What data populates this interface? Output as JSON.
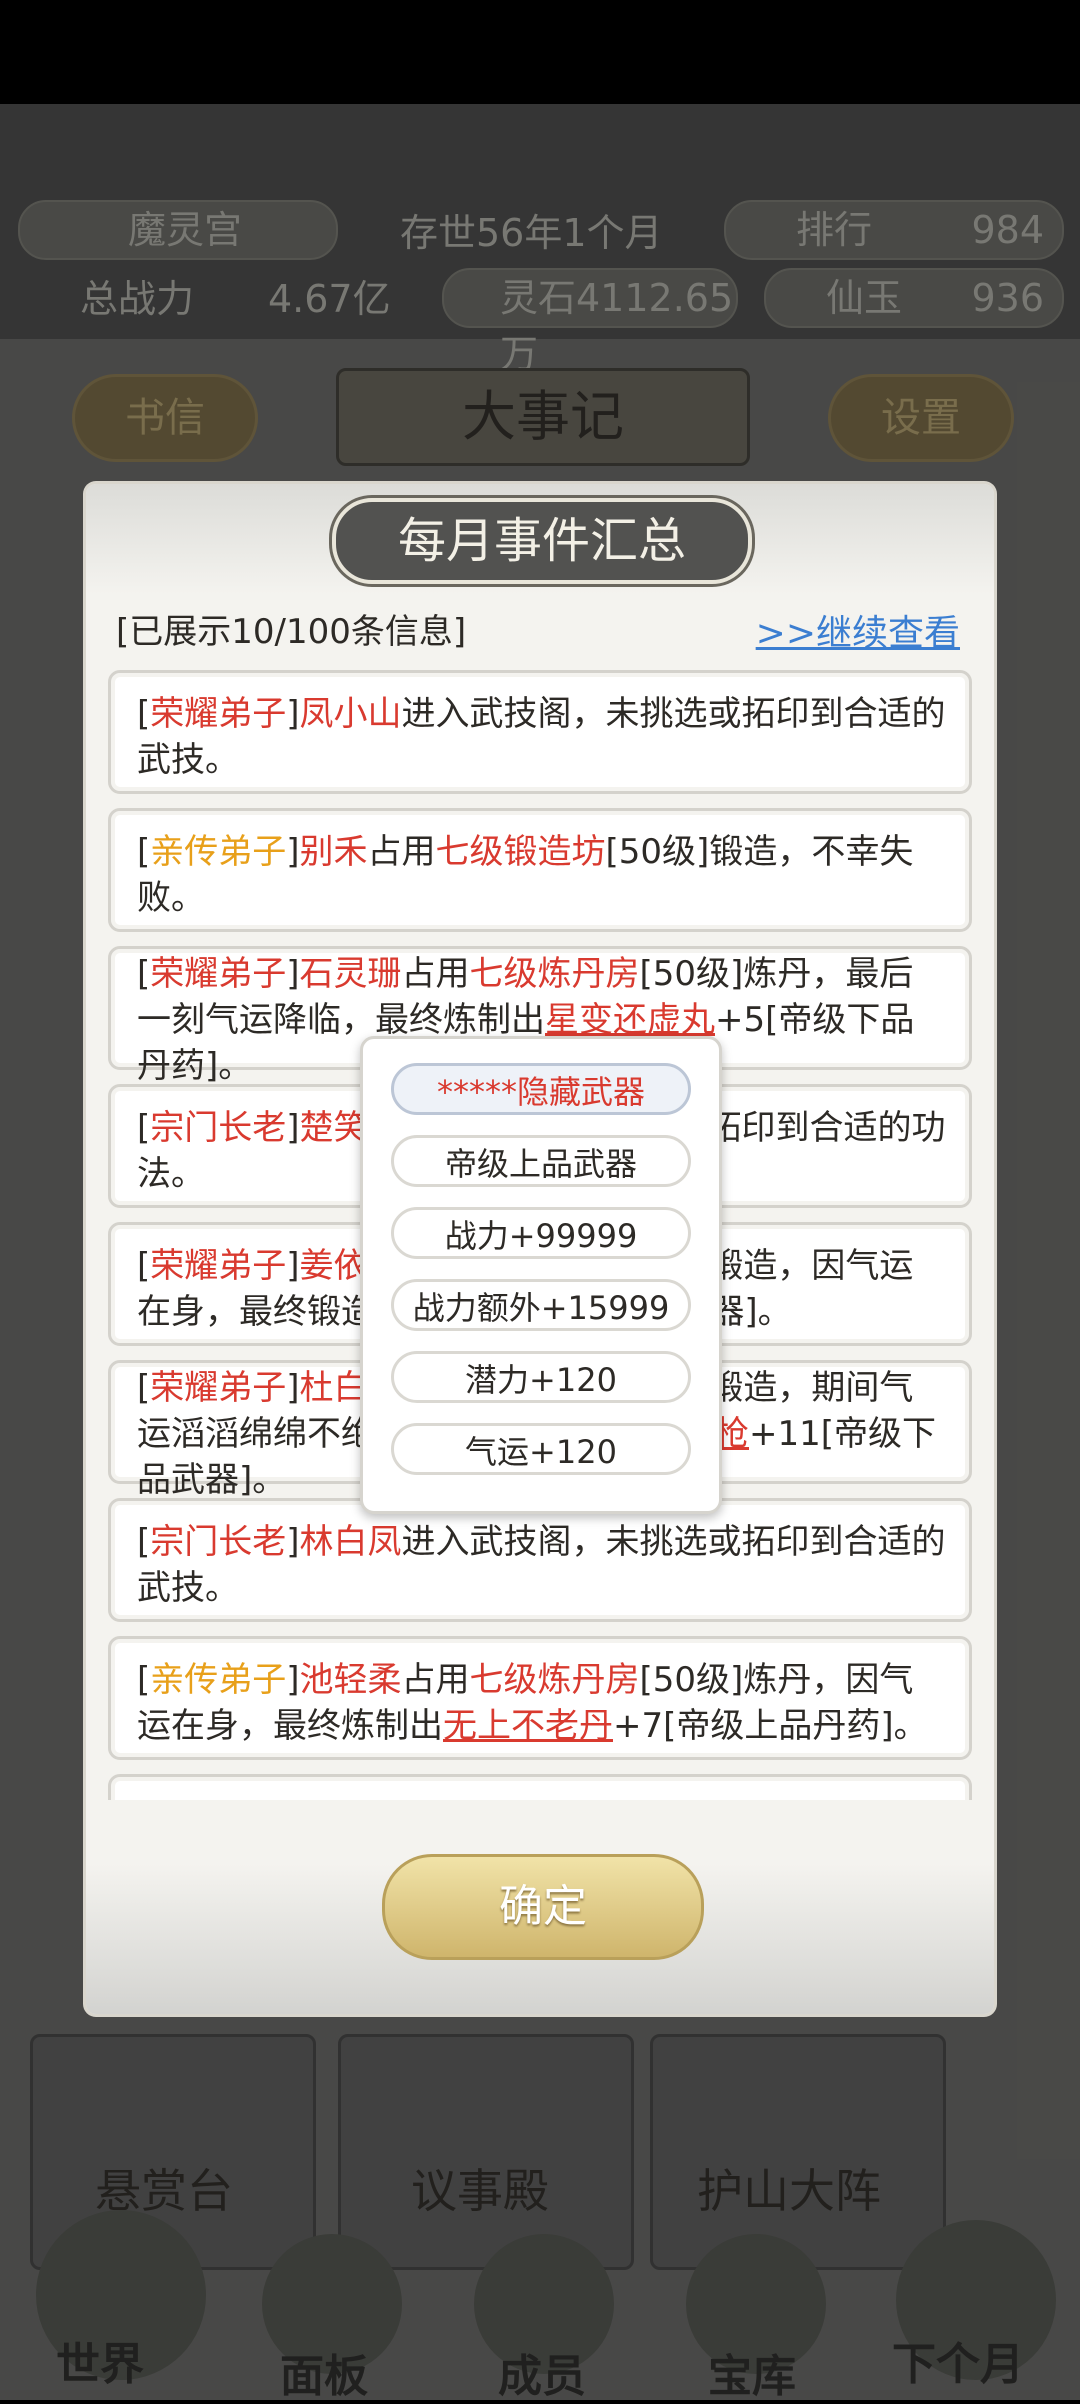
{
  "header": {
    "sect_name": "魔灵宫",
    "existence": "存世56年1个月",
    "rank_label": "排行",
    "rank_value": "984",
    "power_label": "总战力",
    "power_value": "4.67亿",
    "spirit_stone": "灵石4112.65万",
    "jade_label": "仙玉",
    "jade_value": "936"
  },
  "toolbar": {
    "letters": "书信",
    "title": "大事记",
    "settings": "设置"
  },
  "modal": {
    "title": "每月事件汇总",
    "shown_count": "[已展示10/100条信息]",
    "continue_link": ">>继续查看",
    "confirm": "确定"
  },
  "entries": [
    {
      "b1": "[",
      "role": "荣耀弟子",
      "b2": "]",
      "name": "凤小山",
      "text": "进入武技阁，未挑选或拓印到合适的武技。"
    },
    {
      "b1": "[",
      "role": "亲传弟子",
      "b2": "]",
      "name": "别禾",
      "t1": "占用",
      "place": "七级锻造坊",
      "t2": "[50级]锻造，不幸失败。"
    },
    {
      "b1": "[",
      "role": "荣耀弟子",
      "b2": "]",
      "name": "石灵珊",
      "t1": "占用",
      "place": "七级炼丹房",
      "t2": "[50级]炼丹，最后一刻气运降临，最终炼制出",
      "item": "星变还虚丸",
      "t3": "+5[帝级下品丹药]。"
    },
    {
      "b1": "[",
      "role": "宗门长老",
      "b2": "]",
      "name": "楚笑",
      "text": "进入武技阁，未挑选或拓印到合适的功法。"
    },
    {
      "b1": "[",
      "role": "荣耀弟子",
      "b2": "]",
      "name": "姜依",
      "text": "占用七级锻造坊[50级]锻造，因气运在身，最终锻造出某某+9[帝级上品武器]。"
    },
    {
      "b1": "[",
      "role": "荣耀弟子",
      "b2": "]",
      "name": "杜白",
      "t1": "占用七级锻造坊[50级]锻造，期间气运滔滔绵绵不绝，最终锻造出",
      "item": "九天神雷枪",
      "t3": "+11[帝级下品武器]。"
    },
    {
      "b1": "[",
      "role": "宗门长老",
      "b2": "]",
      "name": "林白凤",
      "text": "进入武技阁，未挑选或拓印到合适的武技。"
    },
    {
      "b1": "[",
      "role": "亲传弟子",
      "b2": "]",
      "name": "池轻柔",
      "t1": "占用",
      "place": "七级炼丹房",
      "t2": "[50级]炼丹，因气运在身，最终炼制出",
      "item": "无上不老丹",
      "t3": "+7[帝级上品丹药]。"
    }
  ],
  "tooltip": {
    "name": "*****隐藏武器",
    "grade": "帝级上品武器",
    "power": "战力+99999",
    "extra_power": "战力额外+15999",
    "potential": "潜力+120",
    "luck": "气运+120"
  },
  "tiles": {
    "bounty": "悬赏台",
    "council": "议事殿",
    "defense": "护山大阵"
  },
  "nav": {
    "world": "世界",
    "panel": "面板",
    "members": "成员",
    "treasury": "宝库",
    "next_month": "下个月"
  }
}
